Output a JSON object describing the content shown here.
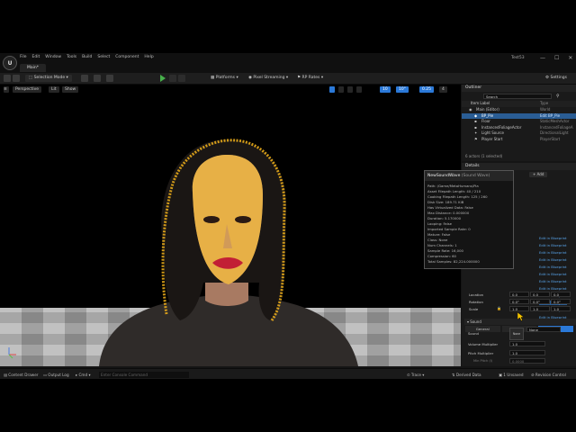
{
  "title_bar": {
    "logo": "U",
    "menu": [
      "File",
      "Edit",
      "Window",
      "Tools",
      "Build",
      "Select",
      "Component",
      "Help"
    ],
    "map_tab": "Main*",
    "project_name": "Test53",
    "window_controls": [
      "—",
      "☐",
      "✕"
    ]
  },
  "toolbar": {
    "mode": "Selection Mode",
    "platforms": "Platforms",
    "pixel_streaming": "Pixel Streaming",
    "rp_rates": "RP Rates",
    "settings": "Settings"
  },
  "viewport": {
    "perspective": "Perspective",
    "lit": "Lit",
    "show": "Show",
    "grid_snap": "10",
    "rot_snap": "10°",
    "scale_snap": "0.25",
    "cam_speed": "4"
  },
  "outliner": {
    "tab": "Outliner",
    "search_placeholder": "Search",
    "col_label": "Item Label",
    "col_type": "Type",
    "rows": [
      {
        "name": "Main (Editor)",
        "type": "World"
      },
      {
        "name": "BP_Pie",
        "type": "Edit BP_Pie"
      },
      {
        "name": "Floor",
        "type": "StaticMeshActor"
      },
      {
        "name": "InstancedFoliageActor",
        "type": "InstancedFoliageA"
      },
      {
        "name": "Light Source",
        "type": "DirectionalLight"
      },
      {
        "name": "Player Start",
        "type": "PlayerStart"
      }
    ],
    "actor_count": "6 actors (1 selected)"
  },
  "details": {
    "tab": "Details",
    "add_label": "Add",
    "edit_links": [
      "Edit in Blueprint",
      "Edit in Blueprint",
      "Edit in Blueprint",
      "Edit in Blueprint",
      "Edit in Blueprint",
      "Edit in Blueprint",
      "Edit in Blueprint",
      "Edit in Blueprint",
      "Edit in Blueprint",
      "Edit in Blueprint",
      "Edit in Blueprint",
      "Edit in Blueprint"
    ],
    "search_placeholder": "Search",
    "filters": [
      "General",
      "Misc",
      "All"
    ],
    "transform": {
      "location": {
        "label": "Location",
        "x": "0.0",
        "y": "0.0",
        "z": "0.0"
      },
      "rotation": {
        "label": "Rotation",
        "x": "0.0°",
        "y": "0.0°",
        "z": "0.0°"
      },
      "scale": {
        "label": "Scale",
        "x": "1.0",
        "y": "1.0",
        "z": "1.0"
      }
    },
    "sound_section": "Sound",
    "sound_label": "Sound",
    "sound_value": "None",
    "volume_label": "Volume Multiplier",
    "volume_value": "1.0",
    "pitch_label": "Pitch Multiplier",
    "pitch_value": "1.0",
    "min_pitch_label": "Min Pitch (I)",
    "min_pitch_value": "0.0000"
  },
  "tooltip": {
    "title": "NewSoundWave",
    "subtitle": "(Sound Wave)",
    "lines": [
      "Path: /Game/MetaHumans/Pia",
      "Asset Filepath Length: 40 / 210",
      "Cooking Filepath Length: 125 / 260",
      "Disk Size: 189.71 KiB",
      "Has Virtualized Data: False",
      "Max Distance: 0.000000",
      "Duration: 5.170000",
      "Looping: False",
      "Imported Sample Rate: 0",
      "Mature: False",
      "Class: None",
      "Num Channels: 1",
      "Sample Rate: 16,000",
      "Compression: 60",
      "Total Samples: 82,224.000000"
    ]
  },
  "status_bar": {
    "content_drawer": "Content Drawer",
    "output_log": "Output Log",
    "cmd": "Cmd",
    "console_placeholder": "Enter Console Command",
    "trace": "Trace",
    "derived_data": "Derived Data",
    "unsaved": "1 Unsaved",
    "revision_control": "Revision Control"
  },
  "colors": {
    "accent": "#2b79d8",
    "selection": "#2a5d94",
    "play": "#47b04b",
    "hair_overlay": "#f2b11a"
  }
}
